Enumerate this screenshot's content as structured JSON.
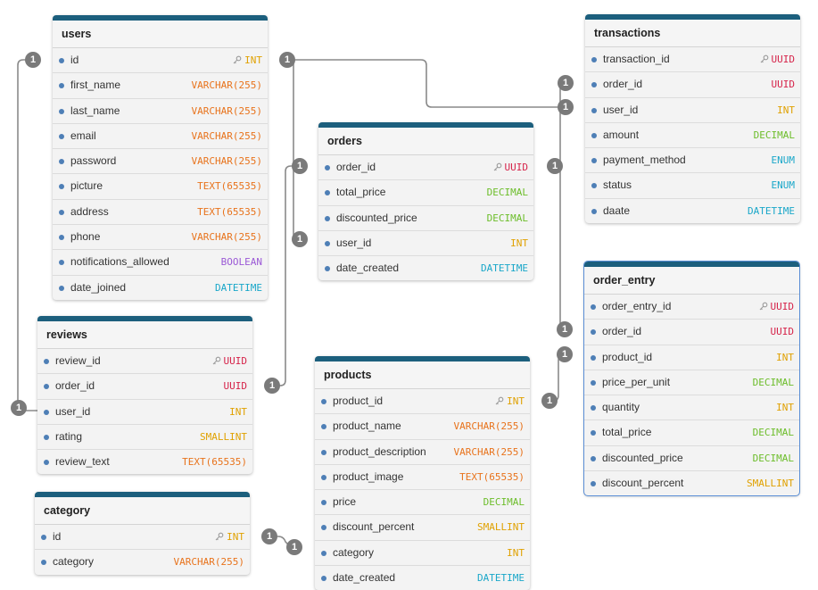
{
  "type_colors": {
    "UUID": "#d6244a",
    "INT": "#e0a100",
    "VARCHAR(255)": "#e8731c",
    "TEXT(65535)": "#e8731c",
    "BOOLEAN": "#9b59d6",
    "DATETIME": "#1aa7c9",
    "DECIMAL": "#6cbd2a",
    "ENUM": "#1aa7c9",
    "SMALLINT": "#e0a100"
  },
  "relationship_label": "1",
  "tables": [
    {
      "name": "users",
      "selected": false,
      "fields": [
        {
          "name": "id",
          "type": "INT",
          "pk": true
        },
        {
          "name": "first_name",
          "type": "VARCHAR(255)"
        },
        {
          "name": "last_name",
          "type": "VARCHAR(255)"
        },
        {
          "name": "email",
          "type": "VARCHAR(255)"
        },
        {
          "name": "password",
          "type": "VARCHAR(255)"
        },
        {
          "name": "picture",
          "type": "TEXT(65535)"
        },
        {
          "name": "address",
          "type": "TEXT(65535)"
        },
        {
          "name": "phone",
          "type": "VARCHAR(255)"
        },
        {
          "name": "notifications_allowed",
          "type": "BOOLEAN"
        },
        {
          "name": "date_joined",
          "type": "DATETIME"
        }
      ]
    },
    {
      "name": "transactions",
      "selected": false,
      "fields": [
        {
          "name": "transaction_id",
          "type": "UUID",
          "pk": true
        },
        {
          "name": "order_id",
          "type": "UUID"
        },
        {
          "name": "user_id",
          "type": "INT"
        },
        {
          "name": "amount",
          "type": "DECIMAL"
        },
        {
          "name": "payment_method",
          "type": "ENUM"
        },
        {
          "name": "status",
          "type": "ENUM"
        },
        {
          "name": "daate",
          "type": "DATETIME"
        }
      ]
    },
    {
      "name": "orders",
      "selected": false,
      "fields": [
        {
          "name": "order_id",
          "type": "UUID",
          "pk": true
        },
        {
          "name": "total_price",
          "type": "DECIMAL"
        },
        {
          "name": "discounted_price",
          "type": "DECIMAL"
        },
        {
          "name": "user_id",
          "type": "INT"
        },
        {
          "name": "date_created",
          "type": "DATETIME"
        }
      ]
    },
    {
      "name": "order_entry",
      "selected": true,
      "fields": [
        {
          "name": "order_entry_id",
          "type": "UUID",
          "pk": true
        },
        {
          "name": "order_id",
          "type": "UUID"
        },
        {
          "name": "product_id",
          "type": "INT"
        },
        {
          "name": "price_per_unit",
          "type": "DECIMAL"
        },
        {
          "name": "quantity",
          "type": "INT"
        },
        {
          "name": "total_price",
          "type": "DECIMAL"
        },
        {
          "name": "discounted_price",
          "type": "DECIMAL"
        },
        {
          "name": "discount_percent",
          "type": "SMALLINT"
        }
      ]
    },
    {
      "name": "reviews",
      "selected": false,
      "fields": [
        {
          "name": "review_id",
          "type": "UUID",
          "pk": true
        },
        {
          "name": "order_id",
          "type": "UUID"
        },
        {
          "name": "user_id",
          "type": "INT"
        },
        {
          "name": "rating",
          "type": "SMALLINT"
        },
        {
          "name": "review_text",
          "type": "TEXT(65535)"
        }
      ]
    },
    {
      "name": "products",
      "selected": false,
      "fields": [
        {
          "name": "product_id",
          "type": "INT",
          "pk": true
        },
        {
          "name": "product_name",
          "type": "VARCHAR(255)"
        },
        {
          "name": "product_description",
          "type": "VARCHAR(255)"
        },
        {
          "name": "product_image",
          "type": "TEXT(65535)"
        },
        {
          "name": "price",
          "type": "DECIMAL"
        },
        {
          "name": "discount_percent",
          "type": "SMALLINT"
        },
        {
          "name": "category",
          "type": "INT"
        },
        {
          "name": "date_created",
          "type": "DATETIME"
        }
      ]
    },
    {
      "name": "category",
      "selected": false,
      "fields": [
        {
          "name": "id",
          "type": "INT",
          "pk": true
        },
        {
          "name": "category",
          "type": "VARCHAR(255)"
        }
      ]
    }
  ]
}
